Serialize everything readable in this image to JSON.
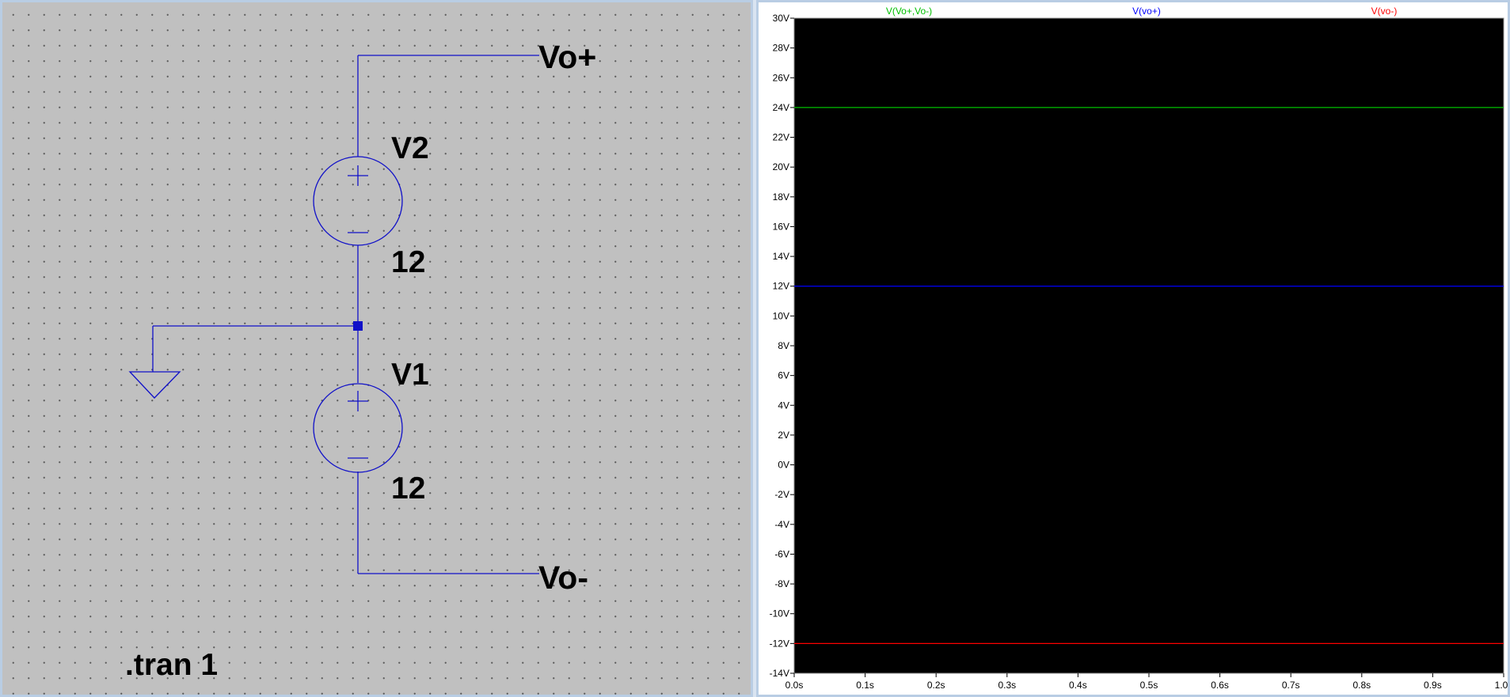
{
  "schematic": {
    "sources": [
      {
        "ref": "V2",
        "value": "12"
      },
      {
        "ref": "V1",
        "value": "12"
      }
    ],
    "net_labels": {
      "top": "Vo+",
      "bottom": "Vo-"
    },
    "directive": ".tran 1",
    "wire_color": "#1010c8"
  },
  "waveform": {
    "background": "#000000",
    "trace_labels": [
      {
        "text": "V(Vo+,Vo-)",
        "color": "#00c000"
      },
      {
        "text": "V(vo+)",
        "color": "#0000ff"
      },
      {
        "text": "V(vo-)",
        "color": "#ff0000"
      }
    ]
  },
  "chart_data": {
    "type": "line",
    "x": [
      0.0,
      1.0
    ],
    "series": [
      {
        "name": "V(Vo+,Vo-)",
        "color": "#00c000",
        "values": [
          24,
          24
        ]
      },
      {
        "name": "V(vo+)",
        "color": "#0000ff",
        "values": [
          12,
          12
        ]
      },
      {
        "name": "V(vo-)",
        "color": "#ff0000",
        "values": [
          -12,
          -12
        ]
      }
    ],
    "xlim": [
      0.0,
      1.0
    ],
    "ylim": [
      -14,
      30
    ],
    "x_ticks": [
      "0.0s",
      "0.1s",
      "0.2s",
      "0.3s",
      "0.4s",
      "0.5s",
      "0.6s",
      "0.7s",
      "0.8s",
      "0.9s",
      "1.0s"
    ],
    "x_tick_values": [
      0.0,
      0.1,
      0.2,
      0.3,
      0.4,
      0.5,
      0.6,
      0.7,
      0.8,
      0.9,
      1.0
    ],
    "y_ticks": [
      "30V",
      "28V",
      "26V",
      "24V",
      "22V",
      "20V",
      "18V",
      "16V",
      "14V",
      "12V",
      "10V",
      "8V",
      "6V",
      "4V",
      "2V",
      "0V",
      "-2V",
      "-4V",
      "-6V",
      "-8V",
      "-10V",
      "-12V",
      "-14V"
    ],
    "y_tick_values": [
      30,
      28,
      26,
      24,
      22,
      20,
      18,
      16,
      14,
      12,
      10,
      8,
      6,
      4,
      2,
      0,
      -2,
      -4,
      -6,
      -8,
      -10,
      -12,
      -14
    ],
    "grid": false,
    "legend": "top"
  }
}
